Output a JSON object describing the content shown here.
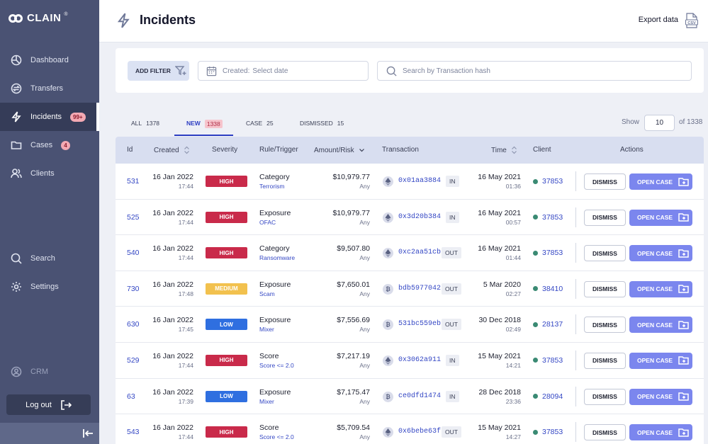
{
  "app": {
    "logo_text": "CLAIN",
    "logo_mark": "®"
  },
  "sidebar": {
    "items": [
      {
        "label": "Dashboard",
        "icon": "dashboard-icon"
      },
      {
        "label": "Transfers",
        "icon": "transfers-icon"
      },
      {
        "label": "Incidents",
        "icon": "bolt-icon",
        "badge": "99+",
        "active": true
      },
      {
        "label": "Cases",
        "icon": "folder-icon",
        "badge": "4"
      },
      {
        "label": "Clients",
        "icon": "users-icon"
      },
      {
        "label": "Search",
        "icon": "search-icon"
      },
      {
        "label": "Settings",
        "icon": "gear-icon"
      },
      {
        "label": "CRM",
        "icon": "user-circle-icon",
        "disabled": true
      }
    ],
    "logout_label": "Log out"
  },
  "header": {
    "title": "Incidents",
    "export_label": "Export data",
    "export_icon": "csv-icon"
  },
  "filters": {
    "add_filter_label": "ADD FILTER",
    "created_label": "Created:",
    "created_value": "Select date",
    "search_placeholder": "Search by Transaction hash"
  },
  "tabs": [
    {
      "label": "ALL",
      "count": "1378"
    },
    {
      "label": "NEW",
      "count": "1338",
      "active": true
    },
    {
      "label": "CASE",
      "count": "25"
    },
    {
      "label": "DISMISSED",
      "count": "15"
    }
  ],
  "pagination": {
    "show_label": "Show",
    "page_size": "10",
    "of_label": "of 1338"
  },
  "table": {
    "columns": [
      "Id",
      "Created",
      "Severity",
      "Rule/Trigger",
      "Amount/Risk",
      "Transaction",
      "Time",
      "Client",
      "Actions"
    ],
    "dismiss_label": "DISMISS",
    "open_case_label": "OPEN CASE",
    "severity_colors": {
      "HIGH": "#c92a4a",
      "MEDIUM": "#f2c14e",
      "LOW": "#2f6fe0"
    },
    "rows": [
      {
        "id": "531",
        "date": "16 Jan 2022",
        "time": "17:44",
        "severity": "HIGH",
        "rule": "Category",
        "trigger": "Terrorism",
        "amount": "$10,979.77",
        "risk": "Any",
        "coin": "eth",
        "hash": "0x01aa3884",
        "dir": "IN",
        "tx_date": "16 May 2021",
        "tx_time": "01:36",
        "client": "37853"
      },
      {
        "id": "525",
        "date": "16 Jan 2022",
        "time": "17:44",
        "severity": "HIGH",
        "rule": "Exposure",
        "trigger": "OFAC",
        "amount": "$10,979.77",
        "risk": "Any",
        "coin": "eth",
        "hash": "0x3d20b384",
        "dir": "IN",
        "tx_date": "16 May 2021",
        "tx_time": "00:57",
        "client": "37853"
      },
      {
        "id": "540",
        "date": "16 Jan 2022",
        "time": "17:44",
        "severity": "HIGH",
        "rule": "Category",
        "trigger": "Ransomware",
        "amount": "$9,507.80",
        "risk": "Any",
        "coin": "eth",
        "hash": "0xc2aa51cb",
        "dir": "OUT",
        "tx_date": "16 May 2021",
        "tx_time": "01:44",
        "client": "37853"
      },
      {
        "id": "730",
        "date": "16 Jan 2022",
        "time": "17:48",
        "severity": "MEDIUM",
        "rule": "Exposure",
        "trigger": "Scam",
        "amount": "$7,650.01",
        "risk": "Any",
        "coin": "btc",
        "hash": "bdb5977042",
        "dir": "OUT",
        "tx_date": "5 Mar 2020",
        "tx_time": "02:27",
        "client": "38410"
      },
      {
        "id": "630",
        "date": "16 Jan 2022",
        "time": "17:45",
        "severity": "LOW",
        "rule": "Exposure",
        "trigger": "Mixer",
        "amount": "$7,556.69",
        "risk": "Any",
        "coin": "btc",
        "hash": "531bc559eb",
        "dir": "OUT",
        "tx_date": "30 Dec 2018",
        "tx_time": "02:49",
        "client": "28137"
      },
      {
        "id": "529",
        "date": "16 Jan 2022",
        "time": "17:44",
        "severity": "HIGH",
        "rule": "Score",
        "trigger": "Score <= 2.0",
        "amount": "$7,217.19",
        "risk": "Any",
        "coin": "eth",
        "hash": "0x3062a911",
        "dir": "IN",
        "tx_date": "15 May 2021",
        "tx_time": "14:21",
        "client": "37853"
      },
      {
        "id": "63",
        "date": "16 Jan 2022",
        "time": "17:39",
        "severity": "LOW",
        "rule": "Exposure",
        "trigger": "Mixer",
        "amount": "$7,175.47",
        "risk": "Any",
        "coin": "btc",
        "hash": "ce0dfd1474",
        "dir": "IN",
        "tx_date": "28 Dec 2018",
        "tx_time": "23:36",
        "client": "28094"
      },
      {
        "id": "543",
        "date": "16 Jan 2022",
        "time": "17:44",
        "severity": "HIGH",
        "rule": "Score",
        "trigger": "Score <= 2.0",
        "amount": "$5,709.54",
        "risk": "Any",
        "coin": "eth",
        "hash": "0x6bebe63f",
        "dir": "OUT",
        "tx_date": "15 May 2021",
        "tx_time": "14:27",
        "client": "37853"
      }
    ]
  }
}
